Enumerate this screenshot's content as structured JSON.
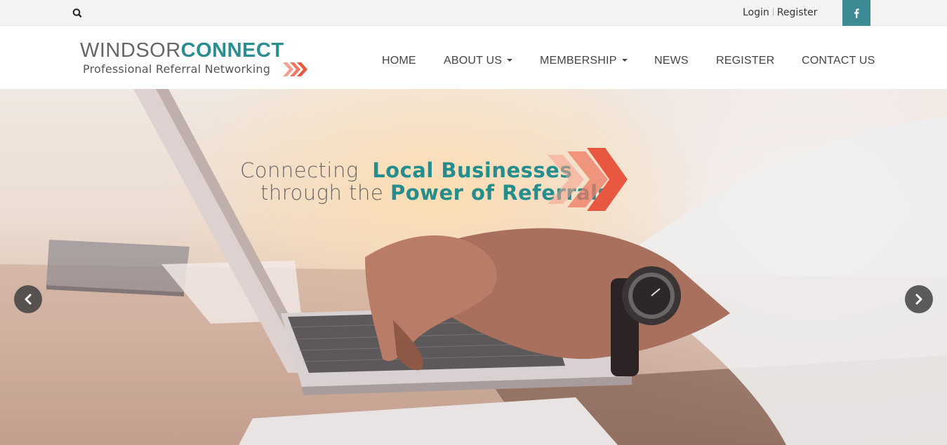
{
  "topbar": {
    "search_icon": "search-icon",
    "login_label": "Login",
    "register_label": "Register",
    "social_icon": "facebook-icon"
  },
  "logo": {
    "brand_light": "WINDSOR",
    "brand_bold": "CONNECT",
    "subtitle": "Professional Referral Networking"
  },
  "nav": {
    "items": [
      {
        "label": "HOME",
        "dropdown": false
      },
      {
        "label": "ABOUT US",
        "dropdown": true
      },
      {
        "label": "MEMBERSHIP",
        "dropdown": true
      },
      {
        "label": "NEWS",
        "dropdown": false
      },
      {
        "label": "REGISTER",
        "dropdown": false
      },
      {
        "label": "CONTACT US",
        "dropdown": false
      }
    ]
  },
  "hero": {
    "line1_plain": "Connecting",
    "line1_highlight": "Local Businesses",
    "line2_plain": "through the",
    "line2_highlight": "Power of Referrals",
    "prev_icon": "chevron-left-icon",
    "next_icon": "chevron-right-icon"
  },
  "colors": {
    "brand_teal": "#2a8d8f",
    "social_bg": "#3c8a93",
    "arrow_coral": "#e8573f",
    "text_grey": "#666666"
  }
}
